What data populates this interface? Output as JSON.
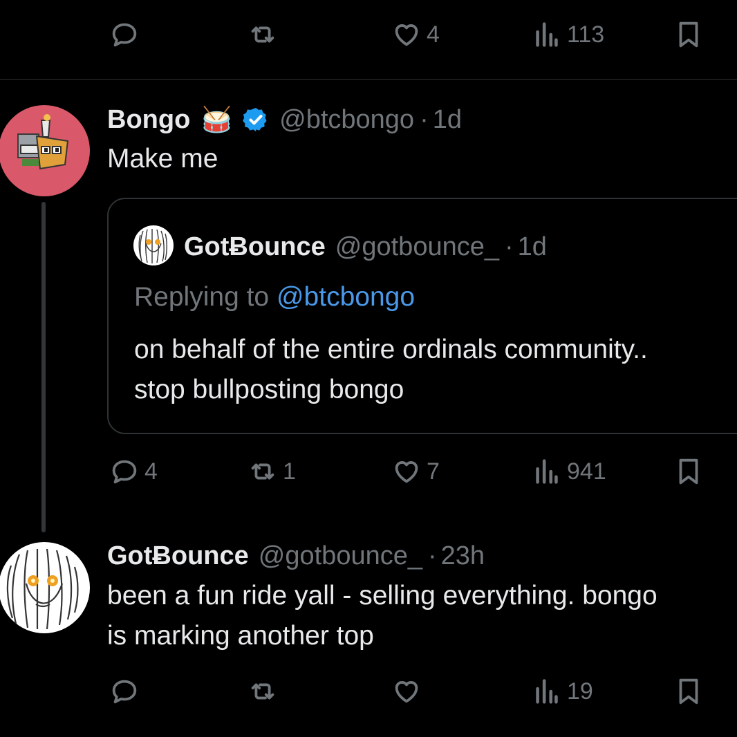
{
  "top_actions": {
    "reply_count": "",
    "repost_count": "",
    "like_count": "4",
    "views_count": "113"
  },
  "main_tweet": {
    "display_name": "Bongo",
    "emoji": "🥁",
    "handle": "@btcbongo",
    "separator": "·",
    "time": "1d",
    "text": "Make me",
    "actions": {
      "reply_count": "4",
      "repost_count": "1",
      "like_count": "7",
      "views_count": "941"
    }
  },
  "quoted_tweet": {
    "display_name": "GotɃounce",
    "handle": "@gotbounce_",
    "separator": "·",
    "time": "1d",
    "replying_prefix": "Replying to",
    "replying_handle": "@btcbongo",
    "text_line1": "on behalf of the entire ordinals community..",
    "text_line2": "stop bullposting bongo"
  },
  "reply_tweet": {
    "display_name": "GotɃounce",
    "handle": "@gotbounce_",
    "separator": "·",
    "time": "23h",
    "text_line1": "been a fun ride yall - selling everything. bongo",
    "text_line2": "is marking another top",
    "actions": {
      "reply_count": "",
      "repost_count": "",
      "like_count": "",
      "views_count": "19"
    }
  },
  "colors": {
    "background": "#000000",
    "text_primary": "#e7e9ea",
    "text_secondary": "#71767b",
    "link": "#4a99e9",
    "verified": "#1d9bf0",
    "border": "#2f3336",
    "bongo_avatar_bg": "#d9596a"
  },
  "icons": [
    "reply-icon",
    "repost-icon",
    "like-icon",
    "views-icon",
    "bookmark-icon",
    "verified-badge-icon"
  ]
}
